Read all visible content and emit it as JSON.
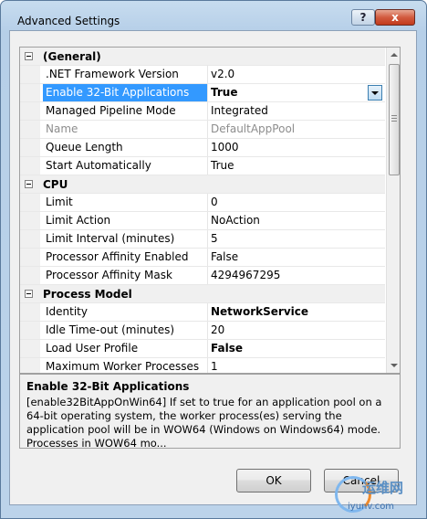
{
  "window": {
    "title": "Advanced Settings",
    "help_label": "?",
    "close_label": "x"
  },
  "grid": {
    "rows": [
      {
        "type": "category",
        "label": "(General)"
      },
      {
        "type": "prop",
        "name": ".NET Framework Version",
        "value": "v2.0"
      },
      {
        "type": "prop",
        "name": "Enable 32-Bit Applications",
        "value": "True",
        "selected": true,
        "bold": true
      },
      {
        "type": "prop",
        "name": "Managed Pipeline Mode",
        "value": "Integrated"
      },
      {
        "type": "prop",
        "name": "Name",
        "value": "DefaultAppPool",
        "disabled": true
      },
      {
        "type": "prop",
        "name": "Queue Length",
        "value": "1000"
      },
      {
        "type": "prop",
        "name": "Start Automatically",
        "value": "True"
      },
      {
        "type": "category",
        "label": "CPU"
      },
      {
        "type": "prop",
        "name": "Limit",
        "value": "0"
      },
      {
        "type": "prop",
        "name": "Limit Action",
        "value": "NoAction"
      },
      {
        "type": "prop",
        "name": "Limit Interval (minutes)",
        "value": "5"
      },
      {
        "type": "prop",
        "name": "Processor Affinity Enabled",
        "value": "False"
      },
      {
        "type": "prop",
        "name": "Processor Affinity Mask",
        "value": "4294967295"
      },
      {
        "type": "category",
        "label": "Process Model"
      },
      {
        "type": "prop",
        "name": "Identity",
        "value": "NetworkService",
        "bold": true
      },
      {
        "type": "prop",
        "name": "Idle Time-out (minutes)",
        "value": "20"
      },
      {
        "type": "prop",
        "name": "Load User Profile",
        "value": "False",
        "bold": true
      },
      {
        "type": "prop",
        "name": "Maximum Worker Processes",
        "value": "1"
      }
    ]
  },
  "description": {
    "title": "Enable 32-Bit Applications",
    "text": "[enable32BitAppOnWin64] If set to true for an application pool on a 64-bit operating system, the worker process(es) serving the application pool will be in WOW64 (Windows on Windows64) mode. Processes in WOW64 mo..."
  },
  "buttons": {
    "ok": "OK",
    "cancel": "Cancel"
  },
  "watermark": {
    "text1": "运维网",
    "text2": "iyunv.com"
  },
  "colors": {
    "selection": "#3399ff",
    "title_bar": "#bcd3ea",
    "close_button": "#c23a1c"
  }
}
